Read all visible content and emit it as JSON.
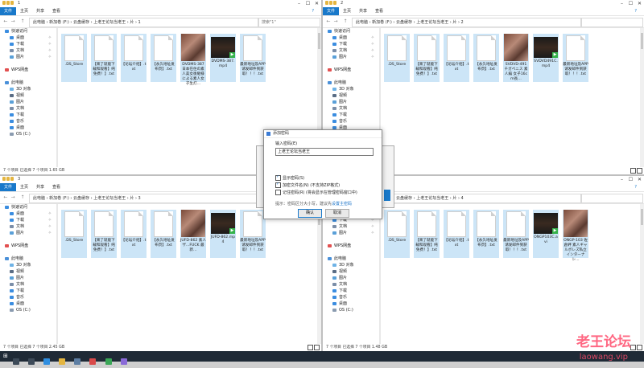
{
  "windows": [
    {
      "id": "w1",
      "title_suffix": "1",
      "tabs": [
        "文件",
        "主页",
        "共享",
        "查看"
      ],
      "path": "此电脑 › 新加卷 (F:) › 云盘缓存 › 上老王论坛当老王 › 片 › 1",
      "search": "搜索\"1\"",
      "status": "7 个项目    已选择 7 个项目 1.65 GB",
      "files": [
        {
          "name": ".DS_Store",
          "kind": "blank"
        },
        {
          "name": "【来了就能下载和观看】纯免费！】.txt",
          "kind": "doc"
        },
        {
          "name": "【论坛介绍】.txt",
          "kind": "doc"
        },
        {
          "name": "【永久地址发布页】.txt",
          "kind": "doc"
        },
        {
          "name": "DVDMS-387 日本在住の素人美女後継様による素人女子生灯…",
          "kind": "img"
        },
        {
          "name": "DVDMS-387.mp4",
          "kind": "vid"
        },
        {
          "name": "最新地址及APP请发邮件到获取！！！.txt",
          "kind": "doc"
        }
      ]
    },
    {
      "id": "w2",
      "title_suffix": "2",
      "tabs": [
        "文件",
        "主页",
        "共享",
        "查看"
      ],
      "path": "此电脑 › 新加卷 (F:) › 云盘缓存 › 上老王论坛当老王 › 片 › 2",
      "search": "",
      "status": "",
      "files": [
        {
          "name": ".DS_Store",
          "kind": "blank"
        },
        {
          "name": "【来了就能下载和观看】纯免费！】.txt",
          "kind": "doc"
        },
        {
          "name": "【论坛介绍】.txt",
          "kind": "doc"
        },
        {
          "name": "【永久地址发布页】.txt",
          "kind": "doc"
        },
        {
          "name": "SVDVD-491 チガペニス 素人編 女子16cm長…",
          "kind": "img"
        },
        {
          "name": "SVDVD491C.mp4",
          "kind": "vid"
        },
        {
          "name": "最新地址及APP请发邮件到获取！！！.txt",
          "kind": "doc"
        }
      ]
    },
    {
      "id": "w3",
      "title_suffix": "3",
      "tabs": [
        "文件",
        "主页",
        "共享",
        "查看"
      ],
      "path": "此电脑 › 新加卷 (F:) › 云盘缓存 › 上老王论坛当老王 › 片 › 3",
      "search": "",
      "status": "7 个项目    已选择 7 个项目 2.45 GB",
      "files": [
        {
          "name": ".DS_Store",
          "kind": "blank"
        },
        {
          "name": "【来了就能下载和观看】纯免费！】.txt",
          "kind": "doc"
        },
        {
          "name": "【论坛介绍】.txt",
          "kind": "doc"
        },
        {
          "name": "【永久地址发布页】.txt",
          "kind": "doc"
        },
        {
          "name": "JUFD-862 素人ザ...FUCK 最新…",
          "kind": "img"
        },
        {
          "name": "JUFD-862.mp4",
          "kind": "vid"
        },
        {
          "name": "最新地址及APP请发邮件到获取！！！.txt",
          "kind": "doc"
        }
      ]
    },
    {
      "id": "w4",
      "title_suffix": "4",
      "tabs": [
        "文件",
        "主页",
        "共享",
        "查看"
      ],
      "path": "此电脑 › 新加卷 (F:) › 云盘缓存 › 上老王论坛当老王 › 片 › 4",
      "search": "",
      "status": "7 个项目    已选择 7 个项目 1.48 GB",
      "files": [
        {
          "name": ".DS_Store",
          "kind": "blank"
        },
        {
          "name": "【来了就能下载和观看】纯免费！】.txt",
          "kind": "doc"
        },
        {
          "name": "【论坛介绍】.txt",
          "kind": "doc"
        },
        {
          "name": "【永久地址发布页】.txt",
          "kind": "doc"
        },
        {
          "name": "最新地址及APP请发邮件到获取！！！.txt",
          "kind": "doc"
        },
        {
          "name": "ONGP103C.avi",
          "kind": "vid"
        },
        {
          "name": "ONGP-103 佐倉絆 素人ギャルボレズ私立インターナシ…",
          "kind": "img"
        }
      ]
    }
  ],
  "sidebar": [
    {
      "label": "快速访问",
      "color": "#3b8de0",
      "pin": false,
      "indent": false
    },
    {
      "label": "桌面",
      "color": "#3b8de0",
      "pin": true,
      "indent": true
    },
    {
      "label": "下载",
      "color": "#3b8de0",
      "pin": true,
      "indent": true
    },
    {
      "label": "文档",
      "color": "#7b8ea8",
      "pin": true,
      "indent": true
    },
    {
      "label": "图片",
      "color": "#5aa0d8",
      "pin": true,
      "indent": true
    },
    {
      "label": "",
      "color": "transparent",
      "pin": false,
      "indent": false
    },
    {
      "label": "WPS网盘",
      "color": "#e25050",
      "pin": false,
      "indent": false
    },
    {
      "label": "",
      "color": "transparent",
      "pin": false,
      "indent": false
    },
    {
      "label": "此电脑",
      "color": "#4a90d9",
      "pin": false,
      "indent": false
    },
    {
      "label": "3D 对象",
      "color": "#6fb3e6",
      "pin": false,
      "indent": true
    },
    {
      "label": "视频",
      "color": "#5a6d85",
      "pin": false,
      "indent": true
    },
    {
      "label": "图片",
      "color": "#5aa0d8",
      "pin": false,
      "indent": true
    },
    {
      "label": "文档",
      "color": "#7b8ea8",
      "pin": false,
      "indent": true
    },
    {
      "label": "下载",
      "color": "#3b8de0",
      "pin": false,
      "indent": true
    },
    {
      "label": "音乐",
      "color": "#3b8de0",
      "pin": false,
      "indent": true
    },
    {
      "label": "桌面",
      "color": "#3b8de0",
      "pin": false,
      "indent": true
    },
    {
      "label": "OS (C:)",
      "color": "#8a9bb0",
      "pin": false,
      "indent": true
    }
  ],
  "dialog": {
    "title": "添加密码",
    "label": "输入密码(E)",
    "value": "上老王论坛当老王",
    "opt1": "显示密码(S)",
    "opt2": "加密文件名(N) (不支持ZIP格式)",
    "opt3": "记住密码(R) (将会显示在管理密码窗口中)",
    "hint_prefix": "提示：密码区分大小写，建议先",
    "hint_link": "设置主密码",
    "ok": "确认",
    "cancel": "取消"
  },
  "watermark": {
    "main": "老王论坛",
    "sub": "laowang.vip"
  },
  "colors": {
    "accent": "#1979ca",
    "taskbar": "#1f2a36",
    "play_badge": "#35b24a"
  }
}
